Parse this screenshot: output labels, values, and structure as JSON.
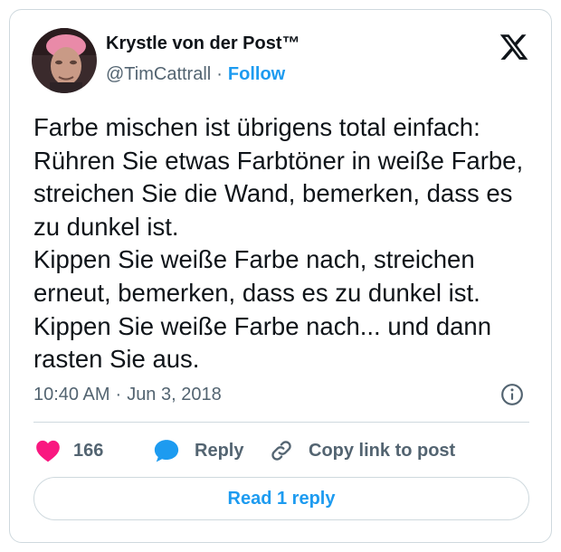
{
  "author": {
    "display_name": "Krystle von der Post™",
    "handle": "@TimCattrall",
    "separator": "·",
    "follow_label": "Follow"
  },
  "tweet": {
    "lines": [
      "Farbe mischen ist übrigens total einfach: Rühren Sie etwas Farbtöner in weiße Farbe, streichen Sie die Wand, bemerken, dass es zu dunkel ist.",
      "Kippen Sie weiße Farbe nach, streichen erneut, bemerken, dass es zu dunkel ist.",
      "Kippen Sie weiße Farbe nach... und dann rasten Sie aus."
    ],
    "time": "10:40 AM",
    "separator": "·",
    "date": "Jun 3, 2018"
  },
  "actions": {
    "like_count": "166",
    "reply_label": "Reply",
    "copy_label": "Copy link to post"
  },
  "replies": {
    "read_label": "Read 1 reply"
  },
  "icons": {
    "platform": "x-logo-icon",
    "info": "info-icon",
    "like": "heart-icon",
    "reply": "speech-bubble-icon",
    "copy": "link-icon"
  },
  "colors": {
    "accent": "#1d9bf0",
    "like": "#f91880",
    "secondary_text": "#536471",
    "border": "#cfd9de"
  }
}
